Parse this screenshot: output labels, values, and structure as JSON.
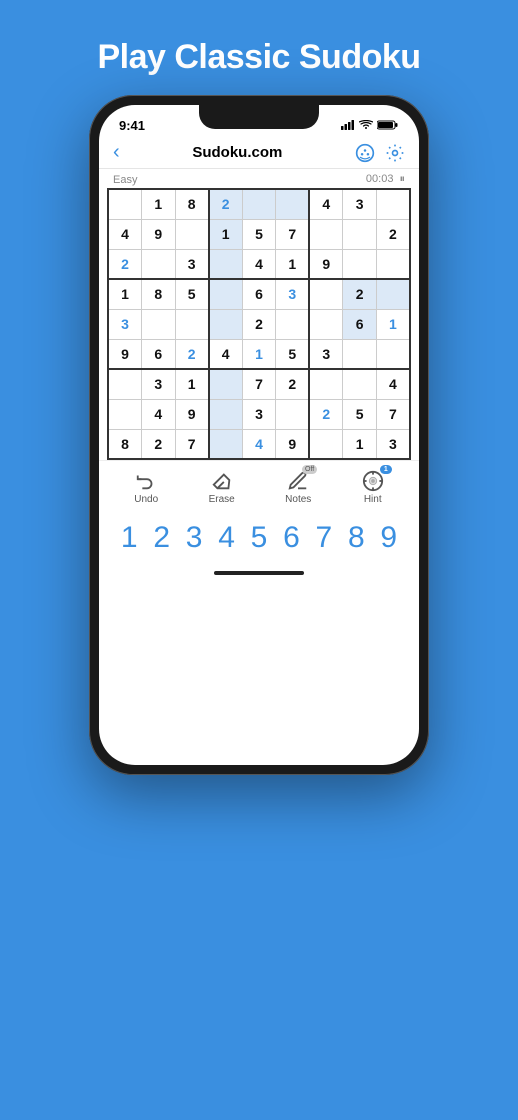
{
  "page": {
    "title": "Play Classic Sudoku",
    "background_color": "#3A8FE0"
  },
  "status_bar": {
    "time": "9:41",
    "signal_icon": "signal-icon",
    "wifi_icon": "wifi-icon",
    "battery_icon": "battery-icon"
  },
  "nav": {
    "back_label": "‹",
    "title": "Sudoku.com",
    "palette_icon": "palette-icon",
    "settings_icon": "settings-icon"
  },
  "game_info": {
    "difficulty": "Easy",
    "timer": "00:03",
    "pause_icon": "pause-icon"
  },
  "sudoku": {
    "grid": [
      [
        "",
        "1",
        "8",
        "2",
        "",
        "",
        "4",
        "3",
        ""
      ],
      [
        "4",
        "9",
        "",
        "1",
        "5",
        "7",
        "",
        "",
        "2"
      ],
      [
        "2",
        "",
        "3",
        "",
        "4",
        "1",
        "9",
        "",
        ""
      ],
      [
        "1",
        "8",
        "5",
        "",
        "6",
        "3",
        "",
        "2",
        ""
      ],
      [
        "3",
        "",
        "",
        "",
        "2",
        "",
        "",
        "6",
        "1"
      ],
      [
        "9",
        "6",
        "2",
        "4",
        "1",
        "5",
        "3",
        "",
        ""
      ],
      [
        "",
        "3",
        "1",
        "",
        "7",
        "2",
        "",
        "",
        "4"
      ],
      [
        "",
        "4",
        "9",
        "",
        "3",
        "",
        "2",
        "5",
        "7"
      ],
      [
        "8",
        "2",
        "7",
        "",
        "4",
        "9",
        "",
        "1",
        "3"
      ]
    ],
    "given_cells": [
      [
        false,
        true,
        true,
        false,
        false,
        false,
        true,
        true,
        false
      ],
      [
        true,
        true,
        false,
        true,
        true,
        true,
        false,
        false,
        true
      ],
      [
        false,
        false,
        true,
        false,
        true,
        true,
        true,
        false,
        false
      ],
      [
        true,
        true,
        true,
        false,
        true,
        false,
        false,
        true,
        false
      ],
      [
        false,
        false,
        false,
        false,
        true,
        false,
        false,
        true,
        false
      ],
      [
        true,
        true,
        false,
        true,
        false,
        true,
        true,
        false,
        false
      ],
      [
        false,
        true,
        true,
        false,
        true,
        true,
        false,
        false,
        true
      ],
      [
        false,
        true,
        true,
        false,
        true,
        false,
        false,
        true,
        true
      ],
      [
        true,
        true,
        true,
        false,
        false,
        true,
        false,
        true,
        true
      ]
    ],
    "user_blue": [
      [
        false,
        false,
        false,
        true,
        false,
        false,
        false,
        false,
        false
      ],
      [
        false,
        false,
        false,
        false,
        false,
        false,
        false,
        false,
        false
      ],
      [
        true,
        false,
        false,
        false,
        false,
        false,
        false,
        false,
        false
      ],
      [
        false,
        false,
        false,
        false,
        false,
        true,
        false,
        false,
        false
      ],
      [
        true,
        false,
        false,
        false,
        false,
        false,
        false,
        false,
        true
      ],
      [
        false,
        false,
        true,
        false,
        true,
        false,
        false,
        false,
        false
      ],
      [
        false,
        false,
        false,
        false,
        false,
        false,
        false,
        false,
        false
      ],
      [
        false,
        false,
        false,
        false,
        false,
        false,
        true,
        false,
        false
      ],
      [
        false,
        false,
        false,
        false,
        true,
        false,
        false,
        false,
        false
      ]
    ],
    "highlighted_cells": [
      [
        false,
        false,
        false,
        true,
        true,
        true,
        false,
        false,
        false
      ],
      [
        false,
        false,
        false,
        true,
        false,
        false,
        false,
        false,
        false
      ],
      [
        false,
        false,
        false,
        true,
        false,
        false,
        false,
        false,
        false
      ],
      [
        false,
        false,
        false,
        true,
        false,
        false,
        false,
        true,
        true
      ],
      [
        false,
        false,
        false,
        true,
        false,
        false,
        false,
        true,
        false
      ],
      [
        false,
        false,
        false,
        false,
        false,
        false,
        false,
        false,
        false
      ],
      [
        false,
        false,
        false,
        true,
        false,
        false,
        false,
        false,
        false
      ],
      [
        false,
        false,
        false,
        true,
        false,
        false,
        false,
        false,
        false
      ],
      [
        false,
        false,
        false,
        true,
        false,
        false,
        false,
        false,
        false
      ]
    ]
  },
  "toolbar": {
    "undo_label": "Undo",
    "erase_label": "Erase",
    "notes_label": "Notes",
    "hint_label": "Hint",
    "notes_badge": "Off",
    "hint_badge": "1"
  },
  "number_pad": {
    "digits": [
      "1",
      "2",
      "3",
      "4",
      "5",
      "6",
      "7",
      "8",
      "9"
    ]
  }
}
